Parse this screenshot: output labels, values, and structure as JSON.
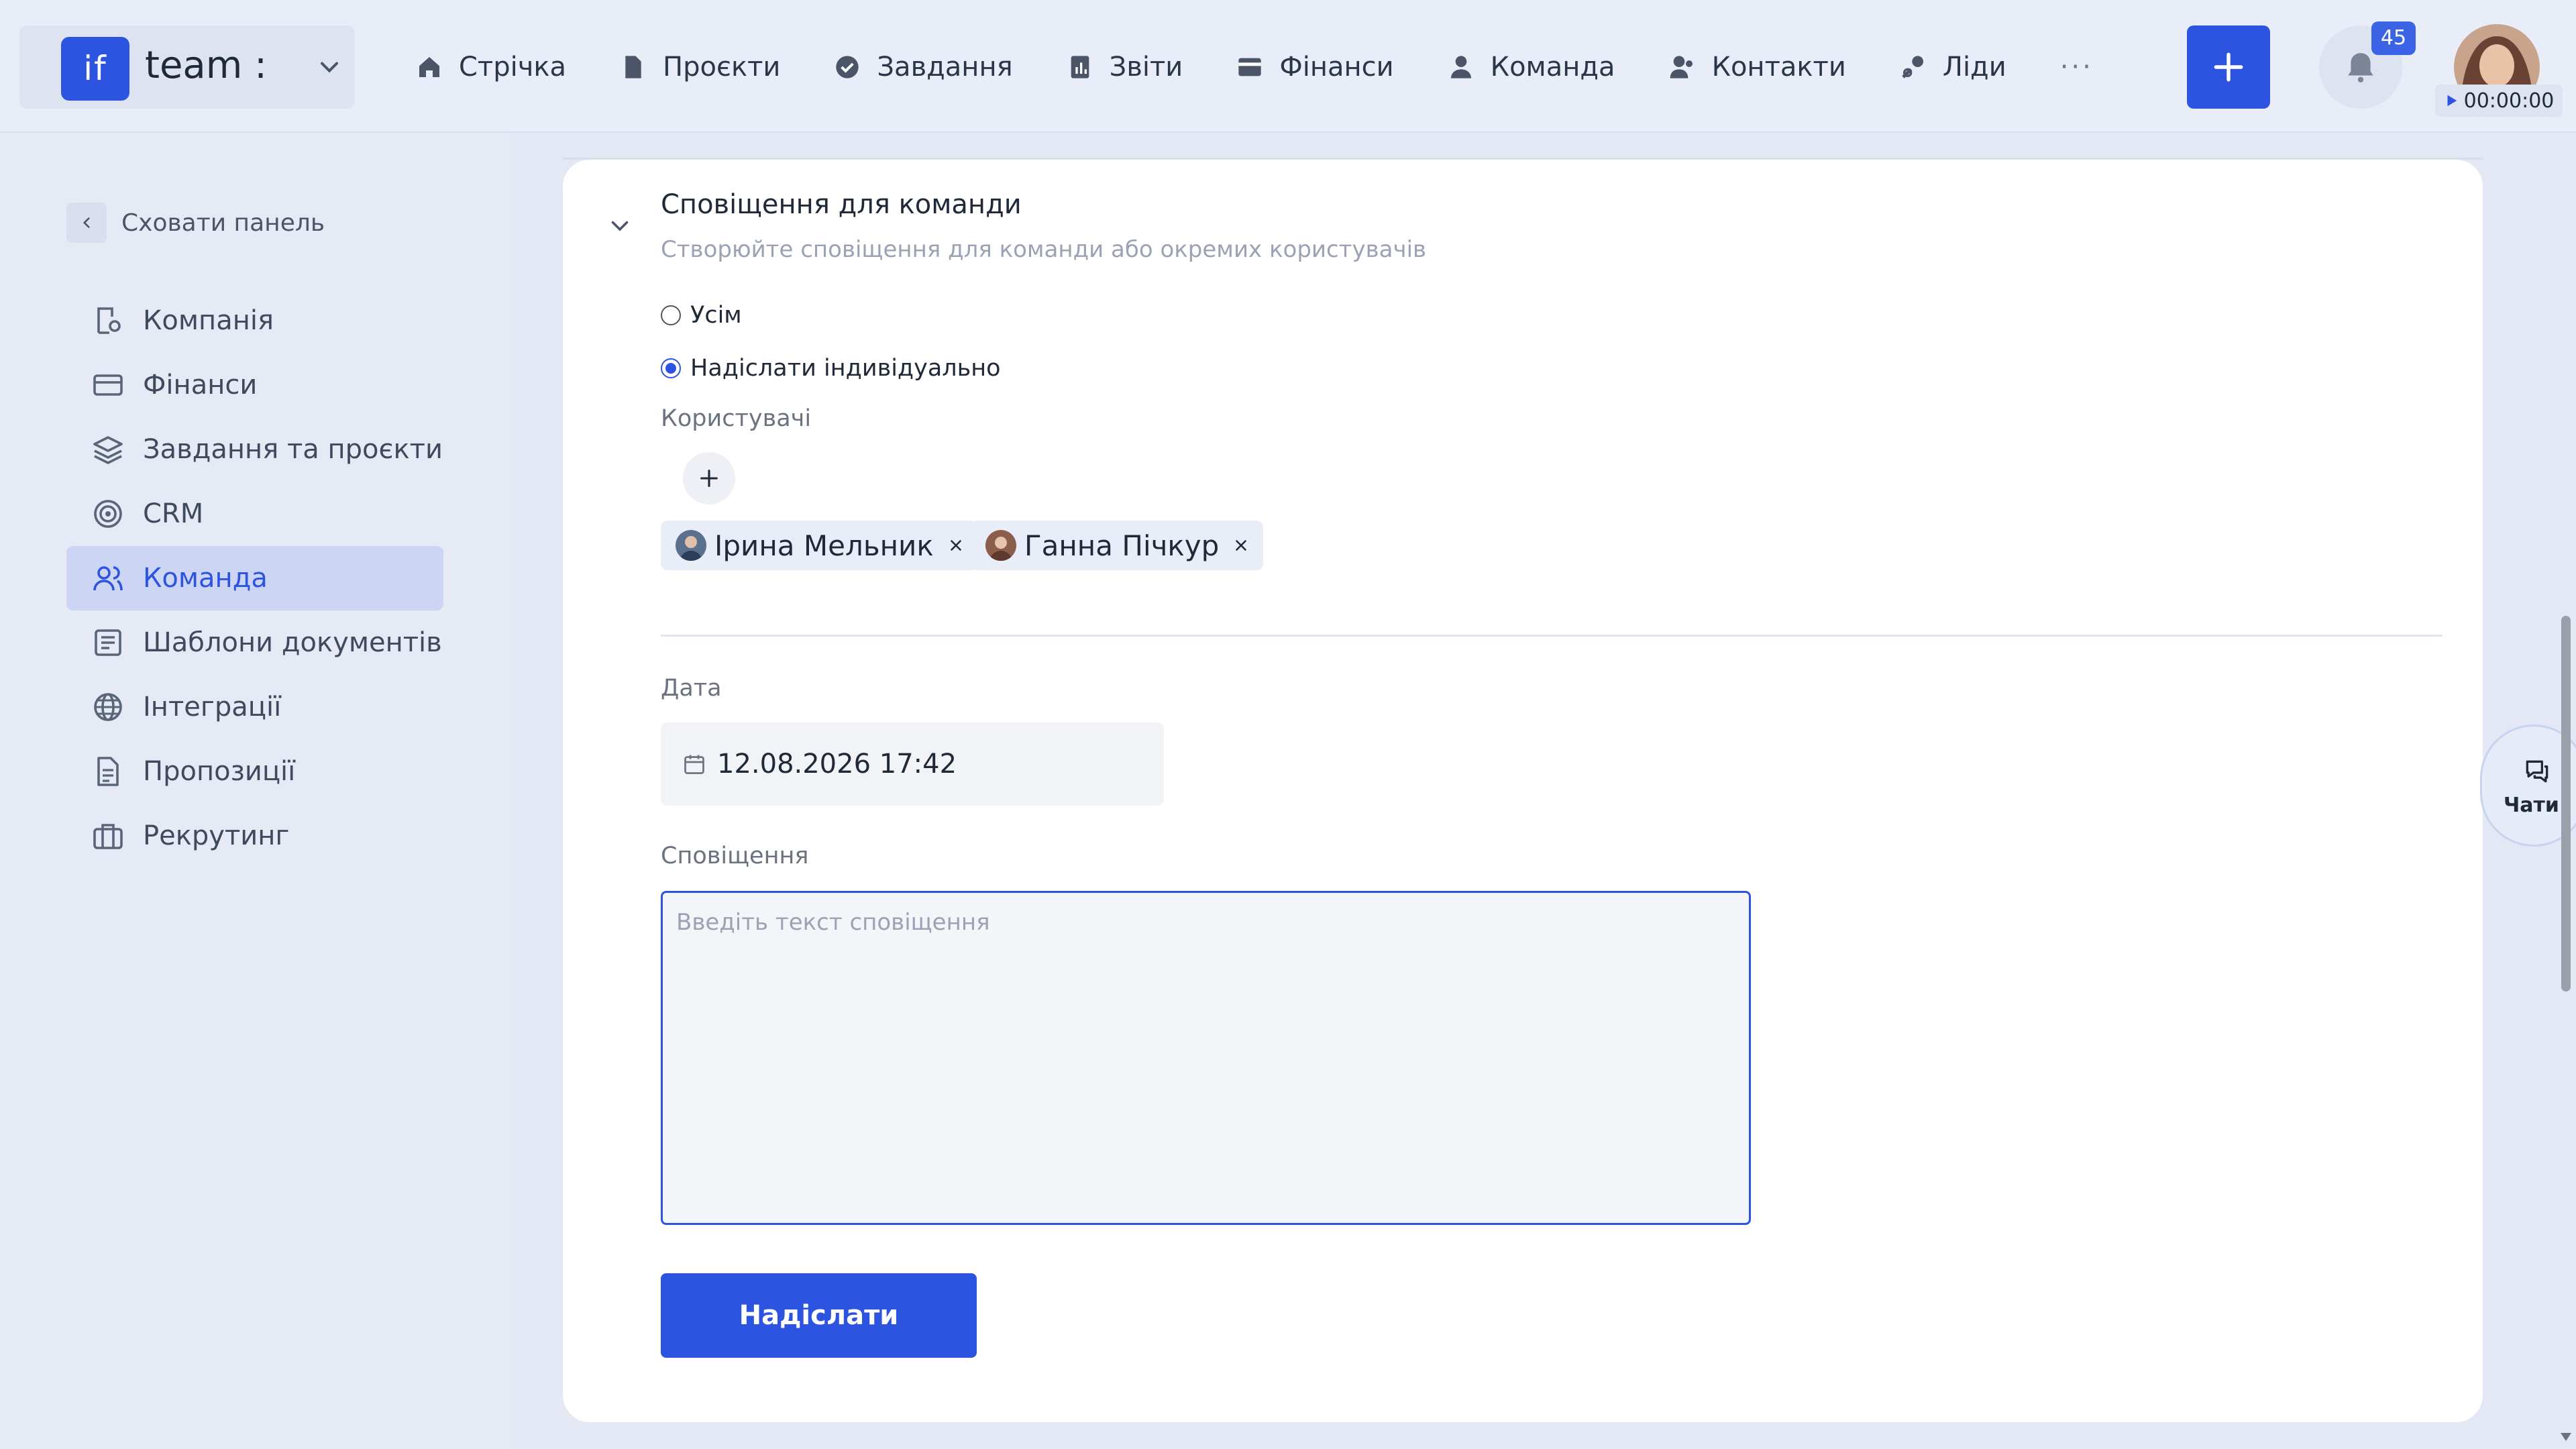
{
  "brand": {
    "logo_text": "if",
    "workspace": "team :"
  },
  "nav": {
    "items": [
      {
        "label": "Стрічка",
        "icon": "home-icon"
      },
      {
        "label": "Проєкти",
        "icon": "document-icon"
      },
      {
        "label": "Завдання",
        "icon": "check-circle-icon"
      },
      {
        "label": "Звіти",
        "icon": "report-icon"
      },
      {
        "label": "Фінанси",
        "icon": "wallet-icon"
      },
      {
        "label": "Команда",
        "icon": "user-icon"
      },
      {
        "label": "Контакти",
        "icon": "contacts-icon"
      },
      {
        "label": "Ліди",
        "icon": "leads-icon"
      }
    ],
    "more": "···"
  },
  "header": {
    "notifications_count": "45",
    "timer": "00:00:00"
  },
  "sidebar": {
    "hide_label": "Сховати панель",
    "items": [
      {
        "label": "Компанія",
        "icon": "company-icon"
      },
      {
        "label": "Фінанси",
        "icon": "card-icon"
      },
      {
        "label": "Завдання та проєкти",
        "icon": "layers-icon"
      },
      {
        "label": "CRM",
        "icon": "target-icon"
      },
      {
        "label": "Команда",
        "icon": "team-icon",
        "active": true
      },
      {
        "label": "Шаблони документів",
        "icon": "template-icon"
      },
      {
        "label": "Інтеграції",
        "icon": "globe-icon"
      },
      {
        "label": "Пропозиції",
        "icon": "proposal-icon"
      },
      {
        "label": "Рекрутинг",
        "icon": "briefcase-icon"
      }
    ]
  },
  "section": {
    "title": "Сповіщення для команди",
    "subtitle": "Створюйте сповіщення для команди або окремих користувачів",
    "radio_all": "Усім",
    "radio_individual": "Надіслати індивідуально",
    "selected_radio": "individual",
    "users_label": "Користувачі",
    "users": [
      "Ірина Мельник",
      "Ганна Пічкур"
    ],
    "date_label": "Дата",
    "date_value": "12.08.2026 17:42",
    "message_label": "Сповіщення",
    "message_placeholder": "Введіть текст сповіщення",
    "message_value": "",
    "send_label": "Надіслати"
  },
  "chats": {
    "label": "Чати"
  },
  "colors": {
    "accent": "#2d54e0",
    "background": "#e3e8f4",
    "card": "#ffffff"
  }
}
